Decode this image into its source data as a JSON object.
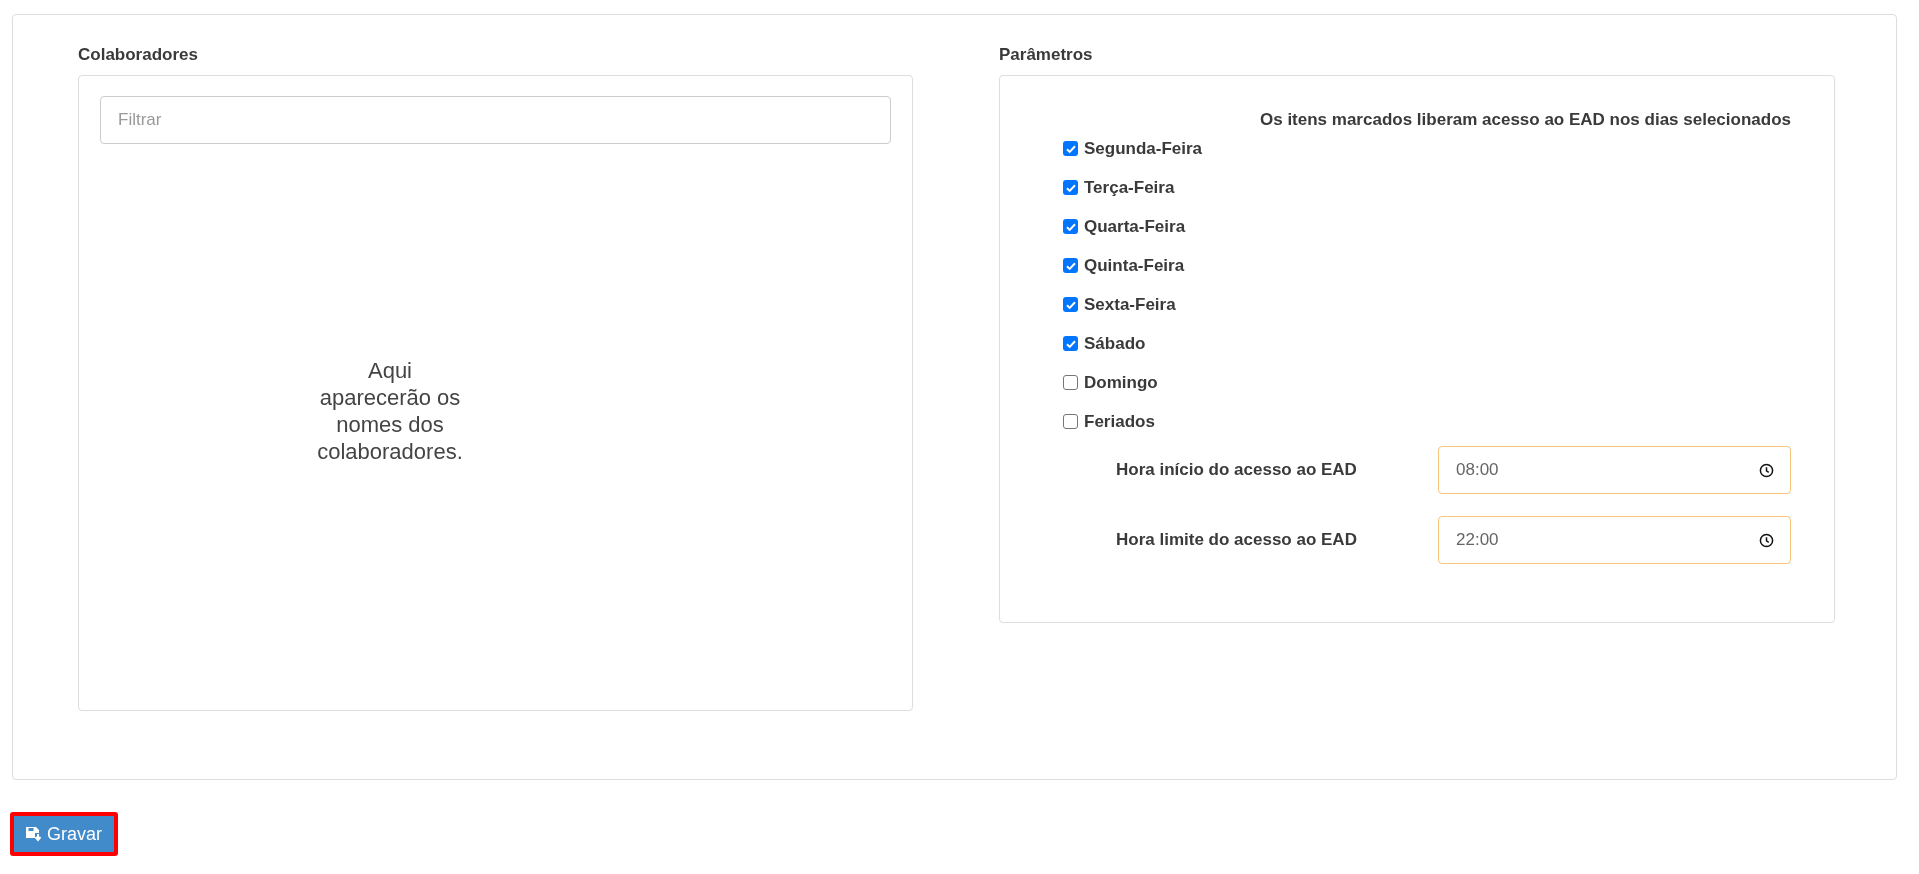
{
  "colaboradores": {
    "title": "Colaboradores",
    "filter": {
      "placeholder": "Filtrar"
    },
    "empty_message": "Aqui aparecerão os nomes dos colaboradores."
  },
  "parametros": {
    "title": "Parâmetros",
    "heading": "Os itens marcados liberam acesso ao EAD nos dias selecionados",
    "days": [
      {
        "label": "Segunda-Feira",
        "checked": true
      },
      {
        "label": "Terça-Feira",
        "checked": true
      },
      {
        "label": "Quarta-Feira",
        "checked": true
      },
      {
        "label": "Quinta-Feira",
        "checked": true
      },
      {
        "label": "Sexta-Feira",
        "checked": true
      },
      {
        "label": "Sábado",
        "checked": true
      },
      {
        "label": "Domingo",
        "checked": false
      },
      {
        "label": "Feriados",
        "checked": false
      }
    ],
    "times": [
      {
        "label": "Hora início do acesso ao EAD",
        "value": "08:00"
      },
      {
        "label": "Hora limite do acesso ao EAD",
        "value": "22:00"
      }
    ]
  },
  "save_button": {
    "label": "Gravar"
  }
}
